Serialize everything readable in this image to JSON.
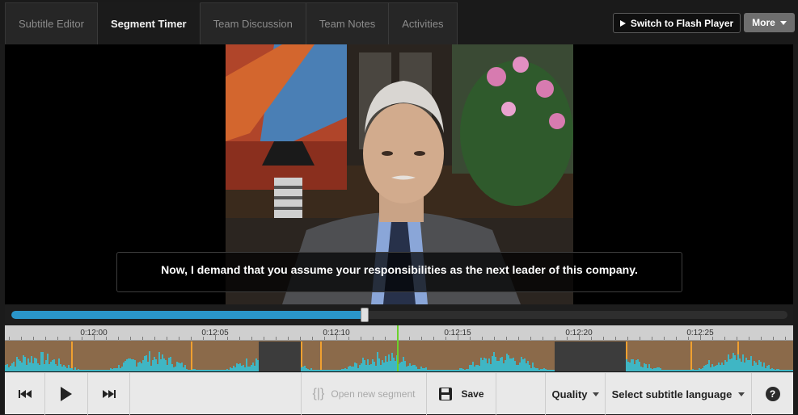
{
  "tabs": [
    {
      "label": "Subtitle Editor",
      "active": false
    },
    {
      "label": "Segment Timer",
      "active": true
    },
    {
      "label": "Team Discussion",
      "active": false
    },
    {
      "label": "Team Notes",
      "active": false
    },
    {
      "label": "Activities",
      "active": false
    }
  ],
  "header": {
    "flash_button_label": "Switch to Flash Player",
    "more_button_label": "More"
  },
  "video": {
    "subtitle_text": "Now, I demand that you assume your responsibilities as the next leader of this company."
  },
  "playback": {
    "progress_fraction": 0.455
  },
  "timeline": {
    "time_labels": [
      "0:12:00",
      "0:12:05",
      "0:12:10",
      "0:12:15",
      "0:12:20",
      "0:12:25"
    ]
  },
  "toolbar": {
    "open_segment_label": "Open new segment",
    "save_label": "Save",
    "quality_label": "Quality",
    "language_label": "Select subtitle language",
    "help_label": "?"
  },
  "colors": {
    "progress": "#2a95c9",
    "segment": "#8b6a4a",
    "segment_edge": "#f0a030",
    "waveform": "#3fb6c4",
    "playhead": "#6bd12c"
  }
}
